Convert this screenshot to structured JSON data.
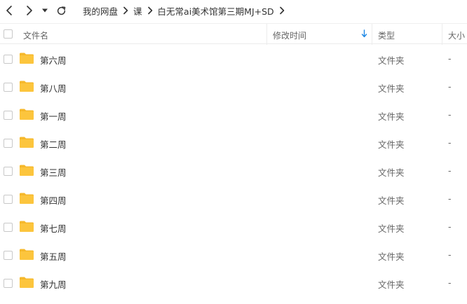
{
  "toolbar": {
    "back_icon": "chevron-left-icon",
    "forward_icon": "chevron-right-icon",
    "history_icon": "caret-down-icon",
    "refresh_icon": "refresh-icon"
  },
  "breadcrumb": [
    "我的网盘",
    "课",
    "白无常ai美术馆第三期MJ+SD"
  ],
  "columns": {
    "name": "文件名",
    "modified": "修改时间",
    "type": "类型",
    "size": "大小"
  },
  "sort": {
    "column": "modified",
    "icon": "arrow-down-icon",
    "color": "#1e88e5"
  },
  "folder_color": "#fcc53d",
  "files": [
    {
      "name": "第六周",
      "modified": "",
      "type": "文件夹",
      "size": "-"
    },
    {
      "name": "第八周",
      "modified": "",
      "type": "文件夹",
      "size": "-"
    },
    {
      "name": "第一周",
      "modified": "",
      "type": "文件夹",
      "size": "-"
    },
    {
      "name": "第二周",
      "modified": "",
      "type": "文件夹",
      "size": "-"
    },
    {
      "name": "第三周",
      "modified": "",
      "type": "文件夹",
      "size": "-"
    },
    {
      "name": "第四周",
      "modified": "",
      "type": "文件夹",
      "size": "-"
    },
    {
      "name": "第七周",
      "modified": "",
      "type": "文件夹",
      "size": "-"
    },
    {
      "name": "第五周",
      "modified": "",
      "type": "文件夹",
      "size": "-"
    },
    {
      "name": "第九周",
      "modified": "",
      "type": "文件夹",
      "size": "-"
    }
  ]
}
